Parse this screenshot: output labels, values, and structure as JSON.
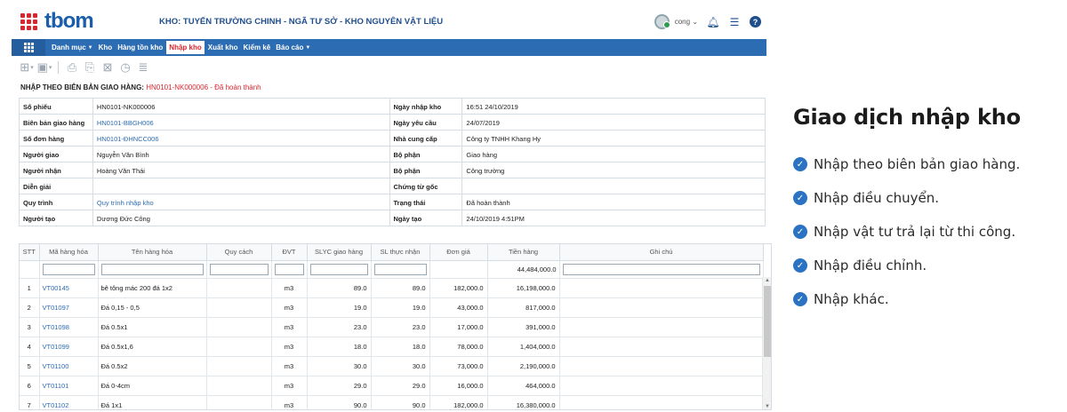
{
  "app": {
    "logo": "tbom",
    "warehouse_title": "KHO: TUYẾN TRƯỜNG CHINH - NGÃ TƯ SỞ - KHO NGUYÊN VẬT LIỆU",
    "user": "cong",
    "accent": "#2b6cb3",
    "brand_red": "#d9262e"
  },
  "nav": {
    "items": [
      {
        "label": "Danh mục",
        "caret": true,
        "active": false
      },
      {
        "label": "Kho",
        "caret": false,
        "active": false
      },
      {
        "label": "Hàng tồn kho",
        "caret": false,
        "active": false
      },
      {
        "label": "Nhập kho",
        "caret": false,
        "active": true
      },
      {
        "label": "Xuất kho",
        "caret": false,
        "active": false
      },
      {
        "label": "Kiểm kê",
        "caret": false,
        "active": false
      },
      {
        "label": "Báo cáo",
        "caret": true,
        "active": false
      }
    ]
  },
  "heading": {
    "prefix": "NHẬP THEO BIÊN BẢN GIAO HÀNG: ",
    "code": "HN0101-NK000006",
    "status": " - Đã hoàn thành"
  },
  "form": {
    "left": [
      {
        "label": "Số phiếu",
        "value": "HN0101-NK000006",
        "link": false
      },
      {
        "label": "Biên bản giao hàng",
        "value": "HN0101-BBGH006",
        "link": true
      },
      {
        "label": "Số đơn hàng",
        "value": "HN0101-ĐHNCC006",
        "link": true
      },
      {
        "label": "Người giao",
        "value": "Nguyễn Văn Bình",
        "link": false
      },
      {
        "label": "Người nhận",
        "value": "Hoàng Văn Thái",
        "link": false
      },
      {
        "label": "Diễn giải",
        "value": "",
        "link": false
      },
      {
        "label": "Quy trình",
        "value": "Quy trình nhập kho",
        "link": true
      },
      {
        "label": "Người tạo",
        "value": "Dương Đức Công",
        "link": false
      }
    ],
    "right": [
      {
        "label": "Ngày nhập kho",
        "value": "16:51 24/10/2019"
      },
      {
        "label": "Ngày yêu cầu",
        "value": "24/07/2019"
      },
      {
        "label": "Nhà cung cấp",
        "value": "Công ty TNHH Khang Hy"
      },
      {
        "label": "Bộ phận",
        "value": "Giao hàng"
      },
      {
        "label": "Bộ phận",
        "value": "Công trường"
      },
      {
        "label": "Chứng từ gốc",
        "value": ""
      },
      {
        "label": "Trạng thái",
        "value": "Đã hoàn thành"
      },
      {
        "label": "Ngày tạo",
        "value": "24/10/2019 4:51PM"
      }
    ]
  },
  "table": {
    "headers": [
      "STT",
      "Mã hàng hóa",
      "Tên hàng hóa",
      "Quy cách",
      "ĐVT",
      "SLYC giao hàng",
      "SL thực nhận",
      "Đơn giá",
      "Tiền hàng",
      "Ghi chú"
    ],
    "total": "44,484,000.0",
    "rows": [
      [
        "1",
        "VT00145",
        "bê tông mác 200 đá 1x2",
        "",
        "m3",
        "89.0",
        "89.0",
        "182,000.0",
        "16,198,000.0",
        ""
      ],
      [
        "2",
        "VT01097",
        "Đá 0,15 - 0,5",
        "",
        "m3",
        "19.0",
        "19.0",
        "43,000.0",
        "817,000.0",
        ""
      ],
      [
        "3",
        "VT01098",
        "Đá 0.5x1",
        "",
        "m3",
        "23.0",
        "23.0",
        "17,000.0",
        "391,000.0",
        ""
      ],
      [
        "4",
        "VT01099",
        "Đá 0.5x1,6",
        "",
        "m3",
        "18.0",
        "18.0",
        "78,000.0",
        "1,404,000.0",
        ""
      ],
      [
        "5",
        "VT01100",
        "Đá 0.5x2",
        "",
        "m3",
        "30.0",
        "30.0",
        "73,000.0",
        "2,190,000.0",
        ""
      ],
      [
        "6",
        "VT01101",
        "Đá 0-4cm",
        "",
        "m3",
        "29.0",
        "29.0",
        "16,000.0",
        "464,000.0",
        ""
      ],
      [
        "7",
        "VT01102",
        "Đá 1x1",
        "",
        "m3",
        "90.0",
        "90.0",
        "182,000.0",
        "16,380,000.0",
        ""
      ]
    ]
  },
  "panel": {
    "title": "Giao dịch nhập kho",
    "items": [
      "Nhập theo biên bản giao hàng.",
      "Nhập điều chuyển.",
      "Nhập vật tư trả lại từ thi công.",
      "Nhập điều chỉnh.",
      "Nhập khác."
    ]
  }
}
